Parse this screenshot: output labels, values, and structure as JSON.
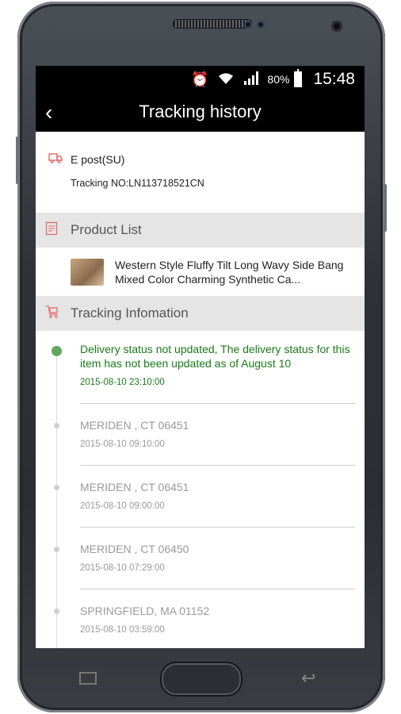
{
  "status_bar": {
    "battery_pct": "80%",
    "time": "15:48",
    "icons": [
      "alarm-icon",
      "wifi-icon",
      "signal-icon",
      "battery-icon"
    ]
  },
  "header": {
    "title": "Tracking history",
    "back_icon": "chevron-left-icon"
  },
  "carrier": {
    "name": "E post(SU)",
    "tracking_no": "Tracking NO:LN113718521CN"
  },
  "product_section": {
    "heading": "Product List",
    "product_name": "Western Style Fluffy Tilt Long Wavy Side Bang Mixed Color Charming Synthetic Ca..."
  },
  "tracking_section": {
    "heading": "Tracking Infomation",
    "events": [
      {
        "text": "Delivery status not updated, The delivery status for this item has not been updated as of August 10",
        "date": "2015-08-10 23:10:00"
      },
      {
        "text": "MERIDEN , CT 06451",
        "date": "2015-08-10 09:10:00"
      },
      {
        "text": "MERIDEN , CT 06451",
        "date": "2015-08-10 09:00:00"
      },
      {
        "text": "MERIDEN , CT 06450",
        "date": "2015-08-10 07:29:00"
      },
      {
        "text": "SPRINGFIELD, MA 01152",
        "date": "2015-08-10 03:59:00"
      }
    ]
  },
  "colors": {
    "accent_green": "#1a7a1a",
    "dot_green": "#5fa85f",
    "icon_red": "#e26b6b"
  }
}
